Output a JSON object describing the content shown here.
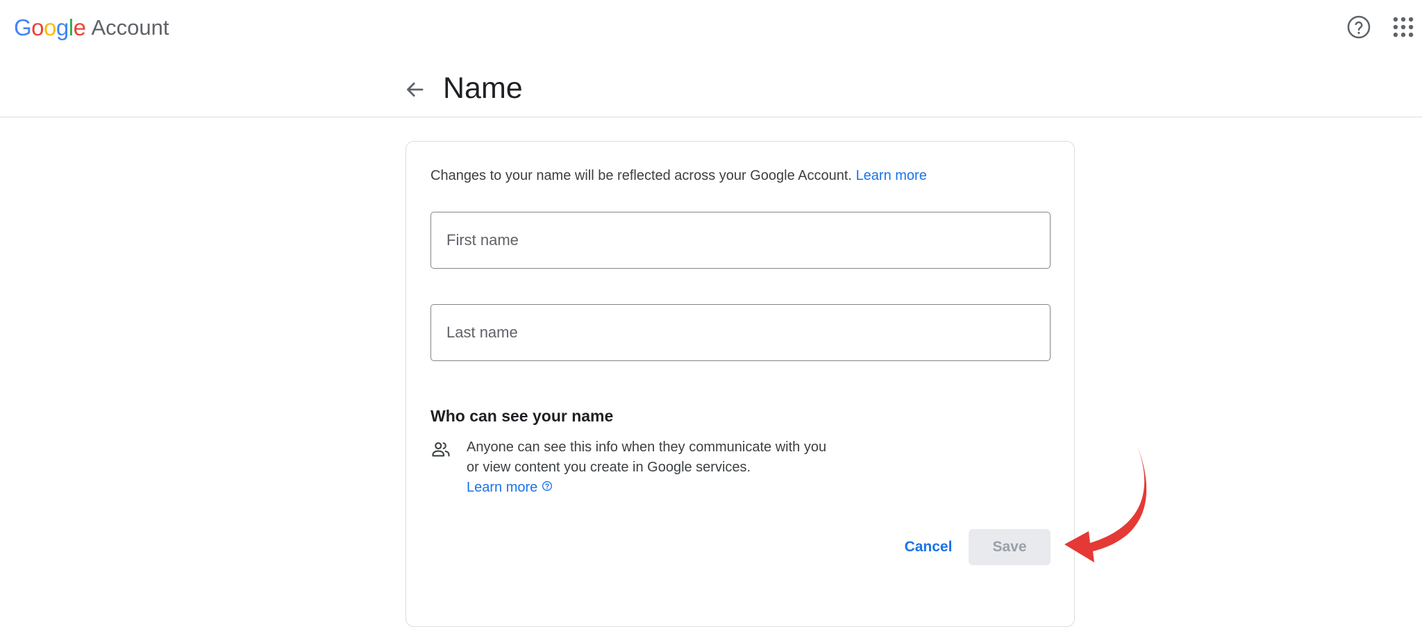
{
  "header": {
    "logo": {
      "letters": [
        "G",
        "o",
        "o",
        "g",
        "l",
        "e"
      ],
      "product": "Account"
    },
    "help_icon": "help-circle-icon",
    "apps_icon": "apps-grid-icon"
  },
  "title_bar": {
    "back_icon": "arrow-back-icon",
    "title": "Name"
  },
  "card": {
    "intro_text": "Changes to your name will be reflected across your Google Account.",
    "intro_link": "Learn more",
    "first_name": {
      "placeholder": "First name",
      "value": ""
    },
    "last_name": {
      "placeholder": "Last name",
      "value": ""
    },
    "visibility": {
      "title": "Who can see your name",
      "icon": "people-icon",
      "text": "Anyone can see this info when they communicate with you or view content you create in Google services.",
      "link": "Learn more"
    },
    "cancel_label": "Cancel",
    "save_label": "Save"
  },
  "annotation": {
    "arrow_color": "#e53935"
  },
  "colors": {
    "accent": "#1a73e8",
    "divider": "#dadce0",
    "disabled_bg": "#e8eaed",
    "disabled_text": "#9aa0a6"
  }
}
